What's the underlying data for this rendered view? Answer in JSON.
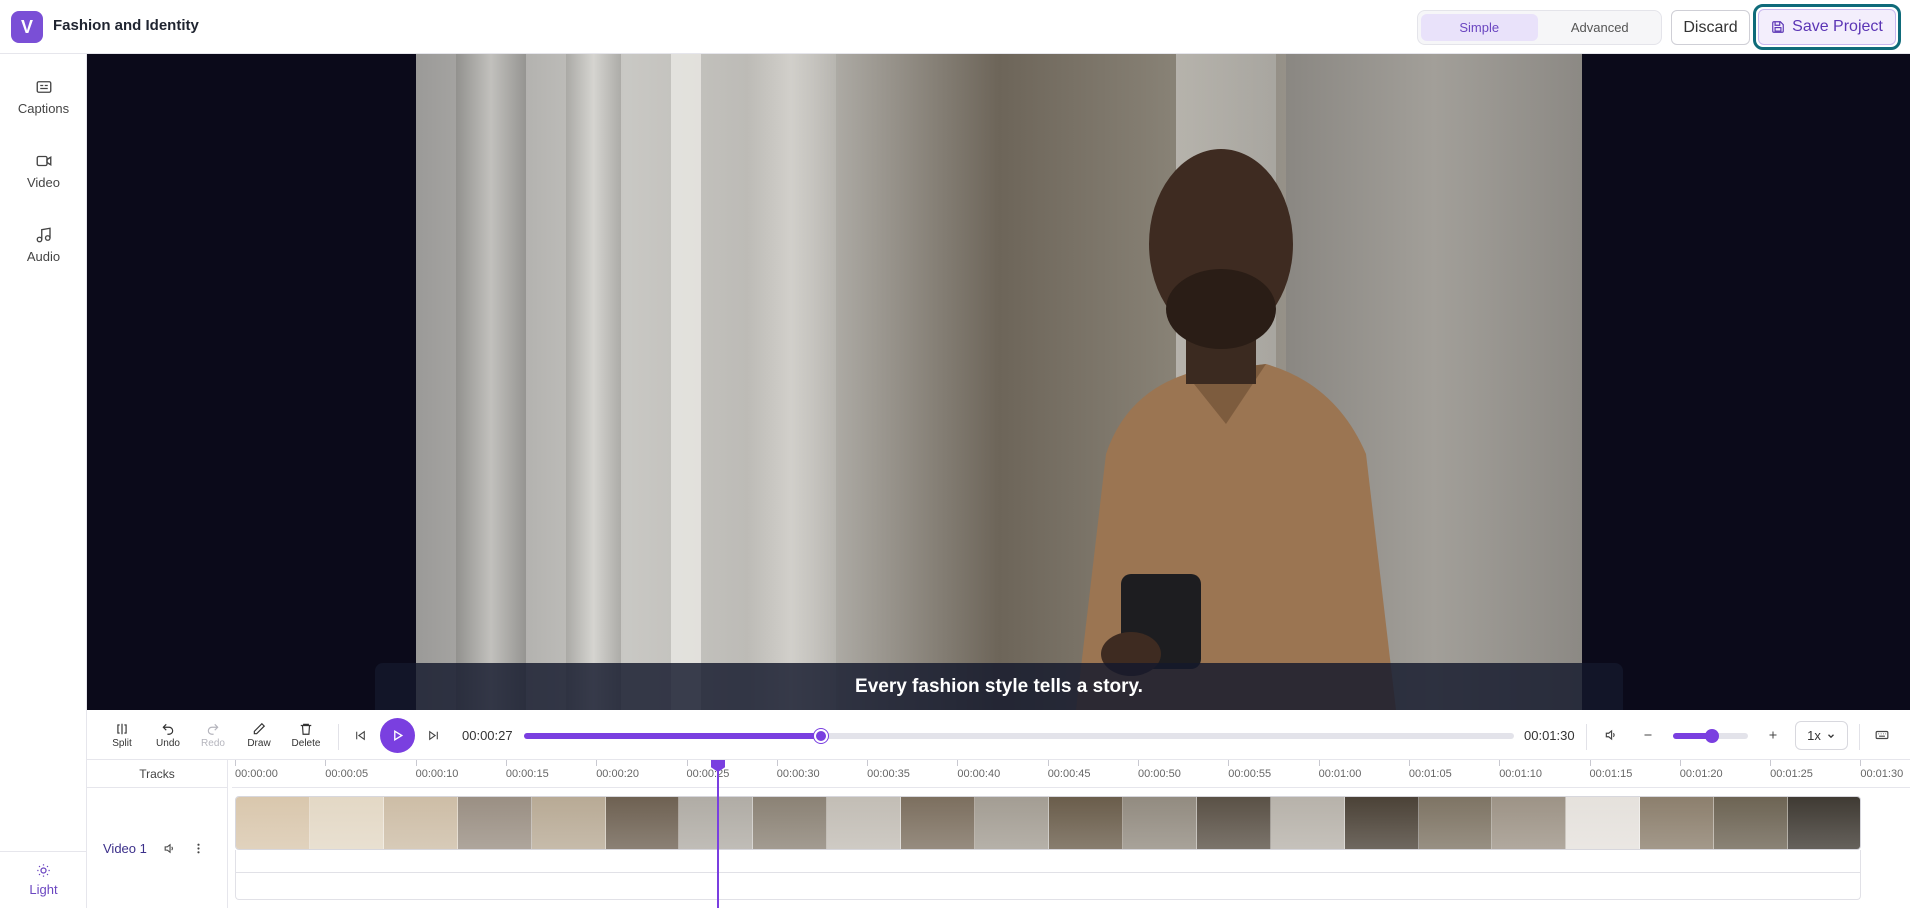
{
  "header": {
    "logo_letter": "V",
    "project_title": "Fashion and Identity",
    "mode_simple": "Simple",
    "mode_advanced": "Advanced",
    "active_mode": "Simple",
    "discard_label": "Discard",
    "save_label": "Save Project"
  },
  "sidebar": {
    "items": [
      {
        "label": "Captions",
        "icon": "captions-icon"
      },
      {
        "label": "Video",
        "icon": "video-camera-icon"
      },
      {
        "label": "Audio",
        "icon": "music-note-icon"
      }
    ],
    "theme_label": "Light"
  },
  "preview": {
    "caption_text": "Every fashion style tells a story."
  },
  "toolbar": {
    "split": "Split",
    "undo": "Undo",
    "redo": "Redo",
    "draw": "Draw",
    "delete": "Delete",
    "current_time": "00:00:27",
    "total_time": "00:01:30",
    "progress_fraction": 0.3,
    "volume_fraction": 0.52,
    "speed": "1x"
  },
  "timeline": {
    "tracks_header": "Tracks",
    "track_name": "Video 1",
    "ticks": [
      "00:00:00",
      "00:00:05",
      "00:00:10",
      "00:00:15",
      "00:00:20",
      "00:00:25",
      "00:00:30",
      "00:00:35",
      "00:00:40",
      "00:00:45",
      "00:00:50",
      "00:00:55",
      "00:01:00",
      "00:01:05",
      "00:01:10",
      "00:01:15",
      "00:01:20",
      "00:01:25",
      "00:01:30"
    ],
    "thumb_colors": [
      "#d9c7ad",
      "#e3d8c5",
      "#cdbda6",
      "#9a8f83",
      "#b8aa95",
      "#6e6152",
      "#b0aca5",
      "#8b8275",
      "#c2bdb5",
      "#7c6f5f",
      "#a39d93",
      "#6a5d4b",
      "#928b80",
      "#5a5146",
      "#b7b2aa",
      "#4b4237",
      "#7e7464",
      "#9d9386",
      "#e5e1dc",
      "#8c7f6d",
      "#6d6454",
      "#3f3a33"
    ]
  },
  "colors": {
    "accent": "#7a3fe0",
    "save_border": "#0f6b7a"
  }
}
